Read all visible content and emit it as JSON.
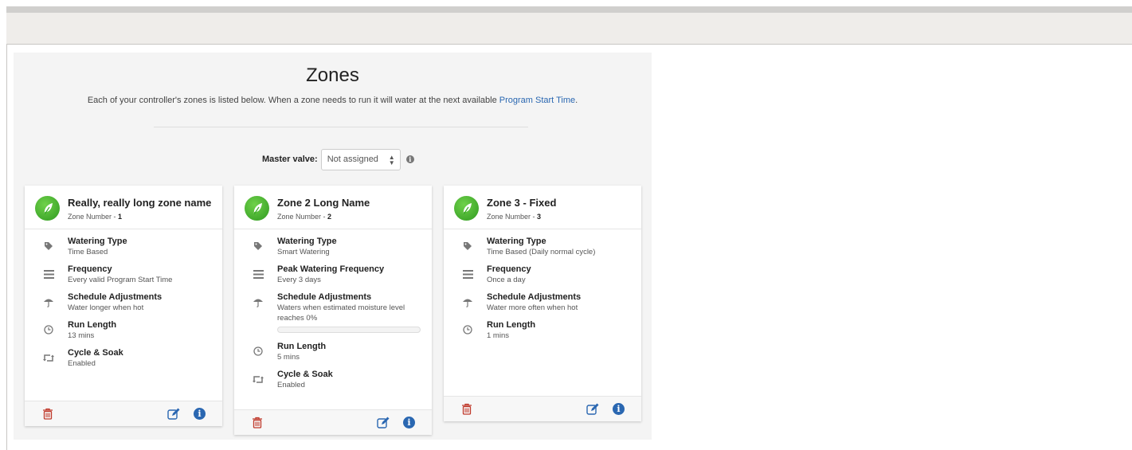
{
  "page": {
    "title": "Zones",
    "subtitle": "Each of your controller's zones is listed below. When a zone needs to run it will water at the next available ",
    "subtitle_link": "Program Start Time",
    "subtitle_end": "."
  },
  "master_valve": {
    "label": "Master valve:",
    "selected": "Not assigned"
  },
  "icons": {
    "zone": "leaf-icon",
    "watering_type": "tag-icon",
    "frequency": "list-icon",
    "schedule": "umbrella-icon",
    "run_length": "clock-icon",
    "cycle": "retweet-icon",
    "delete": "trash-icon",
    "edit": "edit-icon",
    "info": "info-icon"
  },
  "colors": {
    "link": "#2a67b1",
    "delete": "#c0392b",
    "leaf": "#3aa82a"
  },
  "zones": [
    {
      "name": "Really, really long zone name",
      "number_label": "Zone Number - ",
      "number": "1",
      "rows": [
        {
          "title": "Watering Type",
          "value": "Time Based"
        },
        {
          "title": "Frequency",
          "value": "Every valid Program Start Time"
        },
        {
          "title": "Schedule Adjustments",
          "value": "Water longer when hot"
        },
        {
          "title": "Run Length",
          "value": "13 mins"
        },
        {
          "title": "Cycle & Soak",
          "value": "Enabled"
        }
      ]
    },
    {
      "name": "Zone 2 Long Name",
      "number_label": "Zone Number - ",
      "number": "2",
      "rows": [
        {
          "title": "Watering Type",
          "value": "Smart Watering"
        },
        {
          "title": "Peak Watering Frequency",
          "value": "Every 3 days"
        },
        {
          "title": "Schedule Adjustments",
          "value": "Waters when estimated moisture level reaches 0%",
          "moisture_level": 0
        },
        {
          "title": "Run Length",
          "value": "5 mins"
        },
        {
          "title": "Cycle & Soak",
          "value": "Enabled"
        }
      ]
    },
    {
      "name": "Zone 3 - Fixed",
      "number_label": "Zone Number - ",
      "number": "3",
      "rows": [
        {
          "title": "Watering Type",
          "value": "Time Based (Daily normal cycle)"
        },
        {
          "title": "Frequency",
          "value": "Once a day"
        },
        {
          "title": "Schedule Adjustments",
          "value": "Water more often when hot"
        },
        {
          "title": "Run Length",
          "value": "1 mins"
        }
      ]
    }
  ]
}
